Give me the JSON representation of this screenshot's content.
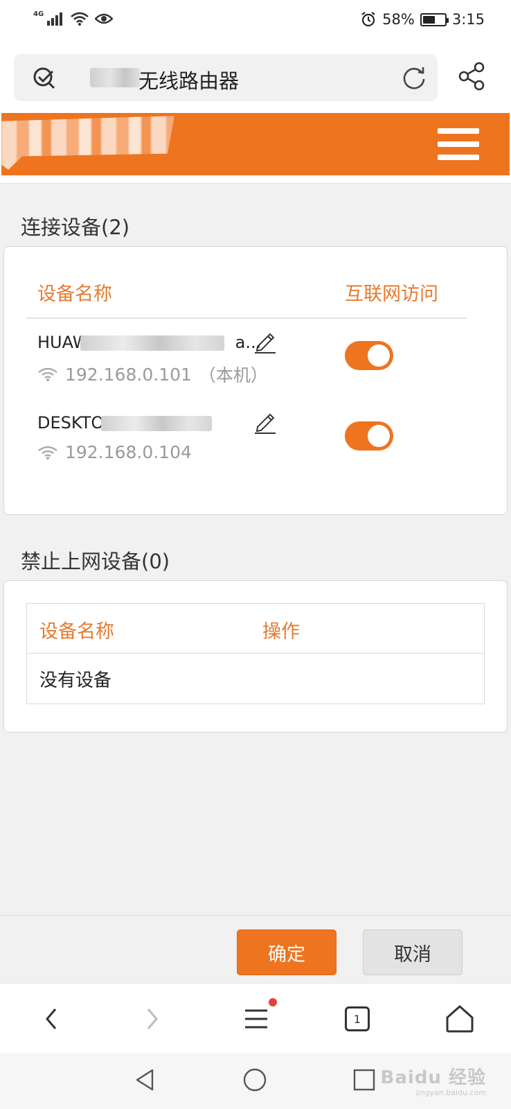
{
  "status_bar": {
    "network_badge": "4G",
    "battery_percent": "58%",
    "time": "3:15"
  },
  "browser": {
    "url_text": "无线路由器"
  },
  "connected": {
    "title": "连接设备(2)",
    "col_name": "设备名称",
    "col_access": "互联网访问",
    "devices": [
      {
        "name_prefix": "HUAWE",
        "name_suffix": "a...",
        "ip": "192.168.0.101",
        "note": "（本机）",
        "internet_access": true
      },
      {
        "name_prefix": "DESKTOP",
        "name_suffix": "",
        "ip": "192.168.0.104",
        "note": "",
        "internet_access": true
      }
    ]
  },
  "blocked": {
    "title": "禁止上网设备(0)",
    "col_name": "设备名称",
    "col_action": "操作",
    "empty_text": "没有设备"
  },
  "footer": {
    "confirm_label": "确定",
    "cancel_label": "取消"
  },
  "browser_nav": {
    "tab_count": "1"
  },
  "watermark": {
    "brand": "Baidu 经验",
    "site": "jingyan.baidu.com"
  },
  "colors": {
    "accent": "#ee7420",
    "heading_orange": "#e67a2e",
    "muted_text": "#9a9a9a",
    "background": "#f1f1f1"
  },
  "icons": {
    "search_engine": "search-engine-icon",
    "reload": "reload-icon",
    "share": "share-icon",
    "menu": "hamburger-menu-icon",
    "edit": "pencil-icon",
    "wifi": "wifi-icon",
    "back": "chevron-left-icon",
    "forward": "chevron-right-icon",
    "browser_menu": "list-menu-icon",
    "tabs": "tabs-icon",
    "home": "home-icon",
    "sys_back": "triangle-back-icon",
    "sys_home": "circle-home-icon",
    "sys_recent": "square-recents-icon"
  }
}
